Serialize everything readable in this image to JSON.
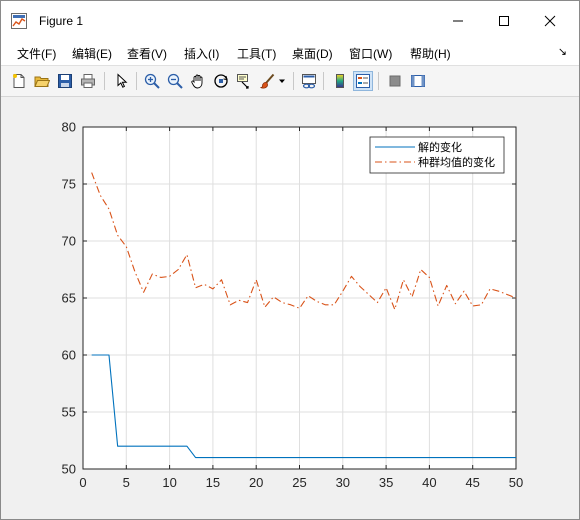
{
  "window": {
    "title": "Figure 1"
  },
  "menu": {
    "items": [
      "文件(F)",
      "编辑(E)",
      "查看(V)",
      "插入(I)",
      "工具(T)",
      "桌面(D)",
      "窗口(W)",
      "帮助(H)"
    ]
  },
  "toolbar": {
    "icons": [
      "new-figure-icon",
      "open-file-icon",
      "save-icon",
      "print-icon",
      "select-arrow-icon",
      "zoom-in-icon",
      "zoom-out-icon",
      "pan-icon",
      "rotate-3d-icon",
      "data-cursor-icon",
      "brush-icon",
      "brush-dropdown-icon",
      "link-plot-icon",
      "insert-colorbar-icon",
      "insert-legend-icon",
      "hide-plot-tools-icon",
      "show-plot-tools-icon"
    ]
  },
  "colors": {
    "series1": "#0072BD",
    "series2": "#D95319",
    "grid": "#dfdfdf",
    "axes": "#262626"
  },
  "chart_data": {
    "type": "line",
    "xlim": [
      0,
      50
    ],
    "ylim": [
      50,
      80
    ],
    "xticks": [
      0,
      5,
      10,
      15,
      20,
      25,
      30,
      35,
      40,
      45,
      50
    ],
    "yticks": [
      50,
      55,
      60,
      65,
      70,
      75,
      80
    ],
    "grid": true,
    "legend_position": "top-right",
    "series": [
      {
        "name": "解的变化",
        "style": "solid",
        "x": [
          1,
          2,
          3,
          4,
          5,
          6,
          7,
          8,
          9,
          10,
          11,
          12,
          13,
          14,
          15,
          16,
          17,
          18,
          19,
          20,
          21,
          22,
          23,
          24,
          25,
          26,
          27,
          28,
          29,
          30,
          31,
          32,
          33,
          34,
          35,
          36,
          37,
          38,
          39,
          40,
          41,
          42,
          43,
          44,
          45,
          46,
          47,
          48,
          49,
          50
        ],
        "values": [
          60,
          60,
          60,
          52,
          52,
          52,
          52,
          52,
          52,
          52,
          52,
          52,
          51,
          51,
          51,
          51,
          51,
          51,
          51,
          51,
          51,
          51,
          51,
          51,
          51,
          51,
          51,
          51,
          51,
          51,
          51,
          51,
          51,
          51,
          51,
          51,
          51,
          51,
          51,
          51,
          51,
          51,
          51,
          51,
          51,
          51,
          51,
          51,
          51,
          51
        ]
      },
      {
        "name": "种群均值的变化",
        "style": "dashdot",
        "x": [
          1,
          2,
          3,
          4,
          5,
          6,
          7,
          8,
          9,
          10,
          11,
          12,
          13,
          14,
          15,
          16,
          17,
          18,
          19,
          20,
          21,
          22,
          23,
          24,
          25,
          26,
          27,
          28,
          29,
          30,
          31,
          32,
          33,
          34,
          35,
          36,
          37,
          38,
          39,
          40,
          41,
          42,
          43,
          44,
          45,
          46,
          47,
          48,
          49,
          50
        ],
        "values": [
          76,
          74,
          72.8,
          70.5,
          69.5,
          67.3,
          65.5,
          67.1,
          66.8,
          66.9,
          67.5,
          68.8,
          65.9,
          66.2,
          65.8,
          66.6,
          64.4,
          64.8,
          64.6,
          66.6,
          64.2,
          65.1,
          64.6,
          64.4,
          64.1,
          65.2,
          64.7,
          64.4,
          64.4,
          65.6,
          66.9,
          66.0,
          65.3,
          64.6,
          65.9,
          64.0,
          66.6,
          65.1,
          67.5,
          66.8,
          64.3,
          66.1,
          64.5,
          65.6,
          64.3,
          64.4,
          65.8,
          65.6,
          65.3,
          65.0
        ]
      }
    ]
  }
}
